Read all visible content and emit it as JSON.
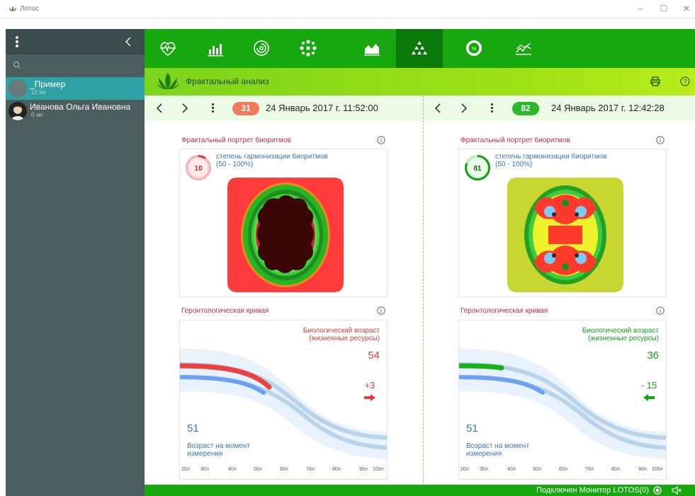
{
  "window": {
    "title": "Лотос"
  },
  "sidebar": {
    "patients": [
      {
        "name": "_Пример",
        "meta": "12 экг",
        "active": true
      },
      {
        "name": "Иванова Ольга Ивановна",
        "meta": "0 экг",
        "active": false
      }
    ]
  },
  "toolbar": {
    "icons": [
      "heart-rate-icon",
      "bar-chart-icon",
      "spiral-icon",
      "molecule-icon",
      "area-chart-icon",
      "fractal-triangle-icon",
      "percent-gauge-icon",
      "trend-line-icon"
    ],
    "active_index": 5
  },
  "module": {
    "title": "Фрактальный анализ"
  },
  "panels": [
    {
      "record": {
        "number": "31",
        "datetime": "24 Январь 2017 г. 11:52:00",
        "badge_color": "#f07a5c"
      },
      "fractal": {
        "title": "Фрактальный портрет биоритмов",
        "harmony_value": "10",
        "harmony_fraction": 0.1,
        "harmony_label": "степень гармонизации биоритмов",
        "harmony_range": "(50 - 100%)",
        "color": "#d93a3a"
      },
      "curve": {
        "title": "Геронтологическая кривая",
        "bio_label_line1": "Биологический возраст",
        "bio_label_line2": "(жизненные ресурсы)",
        "bio_value": "54",
        "delta": "+3",
        "measured_value": "51",
        "measured_label_line1": "Возраст на момент",
        "measured_label_line2": "измерения",
        "color": "#ee3f3f"
      }
    },
    {
      "record": {
        "number": "82",
        "datetime": "24 Январь 2017 г. 12:42:28",
        "badge_color": "#2ab82a"
      },
      "fractal": {
        "title": "Фрактальный портрет биоритмов",
        "harmony_value": "81",
        "harmony_fraction": 0.81,
        "harmony_label": "степень гармонизации биоритмов",
        "harmony_range": "(50 - 100%)",
        "color": "#14a014"
      },
      "curve": {
        "title": "Геронтологическая кривая",
        "bio_label_line1": "Биологический возраст",
        "bio_label_line2": "(жизненные ресурсы)",
        "bio_value": "36",
        "delta": "- 15",
        "measured_value": "51",
        "measured_label_line1": "Возраст на момент",
        "measured_label_line2": "измерения",
        "color": "#19b019"
      }
    }
  ],
  "age_axis": [
    "20л",
    "30л",
    "40л",
    "50л",
    "60л",
    "70л",
    "80л",
    "90л",
    "100л"
  ],
  "status": {
    "text": "Подключен Монитор LOTOS(0)"
  }
}
